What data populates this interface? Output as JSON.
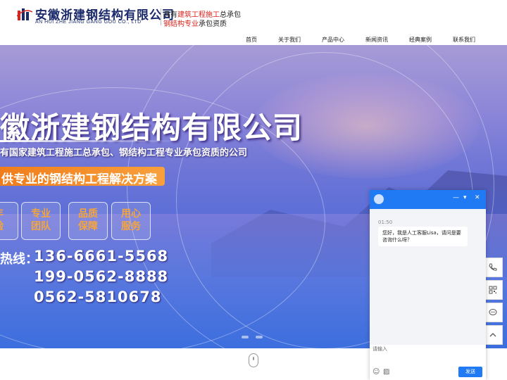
{
  "header": {
    "company_name": "安徽浙建钢结构有限公司",
    "company_en": "AN HUI ZHE JIANG GANG GOU CO., LTD",
    "qualification_line1_a": "具有",
    "qualification_line1_b": "建筑工程施工",
    "qualification_line1_c": "总承包",
    "qualification_line2_a": "钢结构专业",
    "qualification_line2_b": "承包资质"
  },
  "nav": [
    "首页",
    "关于我们",
    "产品中心",
    "新闻资讯",
    "经典案例",
    "联系我们"
  ],
  "banner": {
    "headline": "徽浙建钢结构有限公司",
    "subline": "有国家建筑工程施工总承包、钢结构工程专业承包资质的公司",
    "orange_text": "供专业的钢结构工程解决方案",
    "features": [
      {
        "l1": "丰",
        "l2": "验"
      },
      {
        "l1": "专业",
        "l2": "团队"
      },
      {
        "l1": "品质",
        "l2": "保障"
      },
      {
        "l1": "用心",
        "l2": "服务"
      }
    ],
    "hotline_label": "热线：",
    "phones": [
      "136-6661-5568",
      "199-0562-8888",
      "0562-5810678"
    ]
  },
  "side_tools": [
    "phone-icon",
    "qrcode-icon",
    "chat-icon",
    "back-to-top-icon"
  ],
  "chat": {
    "title": "",
    "time": "01:50",
    "greeting": "您好，我是人工客服Lisa，请问是要咨询什么呀？",
    "input_placeholder": "请输入",
    "send_label": "发送",
    "minimize": "—",
    "expand": "▾",
    "close": "✕"
  },
  "colors": {
    "brand_blue": "#1b2a6b",
    "accent_red": "#d9241c",
    "chat_blue": "#1f7af3",
    "banner_orange": "#f07d1c"
  }
}
